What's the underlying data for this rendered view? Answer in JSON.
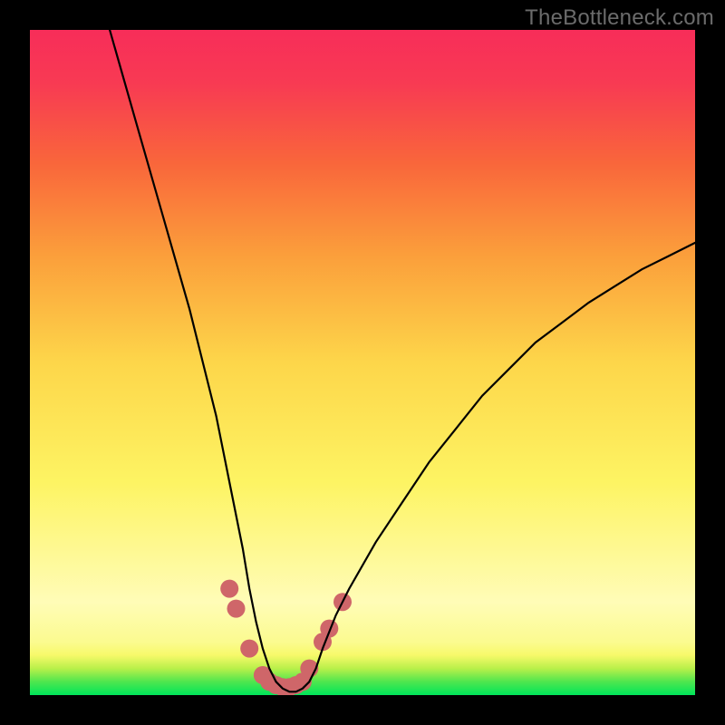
{
  "watermark": "TheBottleneck.com",
  "chart_data": {
    "type": "line",
    "title": "",
    "xlabel": "",
    "ylabel": "",
    "xlim": [
      0,
      100
    ],
    "ylim": [
      0,
      100
    ],
    "grid": false,
    "series": [
      {
        "name": "bottleneck-curve",
        "x": [
          12,
          16,
          20,
          24,
          28,
          30,
          32,
          33,
          34,
          35,
          36,
          37,
          38,
          39,
          40,
          41,
          42,
          43,
          44,
          46,
          48,
          52,
          56,
          60,
          64,
          68,
          72,
          76,
          80,
          84,
          88,
          92,
          96,
          100
        ],
        "values": [
          100,
          86,
          72,
          58,
          42,
          32,
          22,
          16,
          11,
          7,
          4,
          2,
          1,
          0.5,
          0.5,
          1,
          2,
          4,
          7,
          12,
          16,
          23,
          29,
          35,
          40,
          45,
          49,
          53,
          56,
          59,
          61.5,
          64,
          66,
          68
        ]
      }
    ],
    "markers": {
      "name": "highlight-points",
      "x": [
        30,
        31,
        33,
        35,
        36,
        37,
        38,
        39,
        40,
        41,
        42,
        44,
        45,
        47
      ],
      "values": [
        16,
        13,
        7,
        3,
        2,
        1.5,
        1.2,
        1.2,
        1.5,
        2,
        4,
        8,
        10,
        14
      ],
      "color": "#cf6669"
    }
  }
}
